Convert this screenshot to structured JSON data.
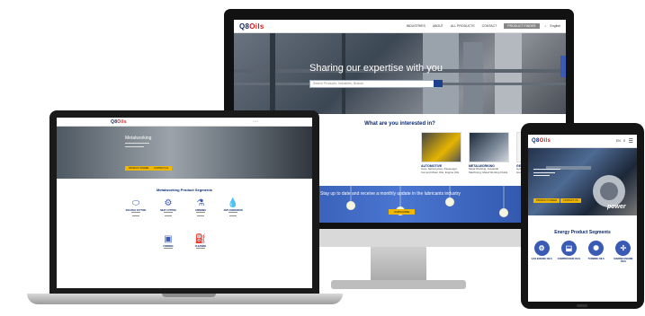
{
  "brand": {
    "logo_text": "Q8",
    "logo_accent": "Oils",
    "primary_color": "#0b2a6e",
    "accent_color": "#d21b1b",
    "button_color": "#f0b700"
  },
  "desktop": {
    "nav_links": [
      "INDUSTRIES",
      "ABOUT",
      "ALL PRODUCTS",
      "CONTACT"
    ],
    "nav_button": "PRODUCT FINDER",
    "language": "English",
    "hero_title": "Sharing our expertise with you",
    "search_placeholder": "Search Products, Industries, Brands",
    "section_title": "What are you interested in?",
    "cards": [
      {
        "title": "AUTOMOTIVE",
        "text": "Cars, Motorcycles, Passenger Car and Motor Oils, Engine Oils"
      },
      {
        "title": "METALWORKING",
        "text": "Metal Working, Industrial Machining, Metal Working Fluids"
      },
      {
        "title": "GENERAL INDUSTRY",
        "text": "Hydraulic, Circulation, Gear Oils, Greases"
      }
    ],
    "banner_text": "Stay up to date and receive a monthly update in the lubricants industry",
    "banner_button": "SUBSCRIBE"
  },
  "laptop": {
    "hero_title": "Metalworking",
    "hero_buttons": [
      "PRODUCT FINDER",
      "CONTACT US"
    ],
    "section_title": "Metalworking Product Segments",
    "segments": [
      {
        "label": "SOLUBLE CUTTING",
        "icon": "droplet-icon"
      },
      {
        "label": "NEAT CUTTING",
        "icon": "gear-icon"
      },
      {
        "label": "GRINDING",
        "icon": "flask-icon"
      },
      {
        "label": "ANTI-CORROSION",
        "icon": "drops-icon"
      },
      {
        "label": "FORMING",
        "icon": "press-icon"
      },
      {
        "label": "CLEANING",
        "icon": "oilcan-icon"
      }
    ]
  },
  "tablet": {
    "language": "EN",
    "hero_buttons": [
      "PRODUCT FINDER",
      "CONTACT US"
    ],
    "hero_badge": "power",
    "section_title": "Energy Product Segments",
    "segments": [
      {
        "label": "GAS ENGINE OILS",
        "icon": "engine-icon"
      },
      {
        "label": "COMPRESSOR OILS",
        "icon": "compressor-icon"
      },
      {
        "label": "TURBINE OILS",
        "icon": "turbine-icon"
      },
      {
        "label": "MARINE ENGINE OILS",
        "icon": "propeller-icon"
      }
    ]
  }
}
